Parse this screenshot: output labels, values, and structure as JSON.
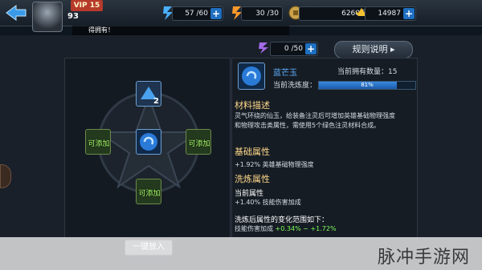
{
  "header": {
    "vip_label": "VIP 15",
    "level": "93",
    "resources": [
      {
        "icon": "energy-icon",
        "value": "57 /60"
      },
      {
        "icon": "stamina-icon",
        "value": "30 /30"
      },
      {
        "icon": "coin-icon",
        "value": "6260万"
      },
      {
        "icon": "ingot-icon",
        "value": "14987"
      }
    ],
    "ticker": "得拥有！"
  },
  "refine": {
    "stone_count": "0 /50",
    "rules_label": "规则说明",
    "center_count": "2",
    "add_label": "可添加"
  },
  "item": {
    "name": "蓝芒玉",
    "owned_label": "当前拥有数量：15",
    "refine_label": "当前洗炼度：",
    "refine_percent_text": "81%",
    "refine_fraction": 0.81
  },
  "sections": {
    "material_title": "材料描述",
    "material_desc_1": "灵气环绕的仙玉，给装备注灵后可增加英雄基础物理强度",
    "material_desc_2": "和物理攻击类属性，需使用5个绿色注灵材料合成。",
    "base_title": "基础属性",
    "base_value": "+1.92% 英雄基础物理强度",
    "refine_title": "洗炼属性",
    "current_attr_label": "当前属性",
    "current_attr_value": "+1.40% 技能伤害加成",
    "range_label": "洗炼后属性的变化范围如下：",
    "range_prefix": "技能伤害加成",
    "range_min": "+0.34%",
    "range_sep": "~",
    "range_max": "+1.72%"
  },
  "footer": {
    "one_key_label": "一键放入",
    "watermark": "脉冲手游网"
  },
  "colors": {
    "accent_blue": "#1f6fc0",
    "add_green": "#a8ff6a",
    "section_gold": "#ffd98a"
  }
}
